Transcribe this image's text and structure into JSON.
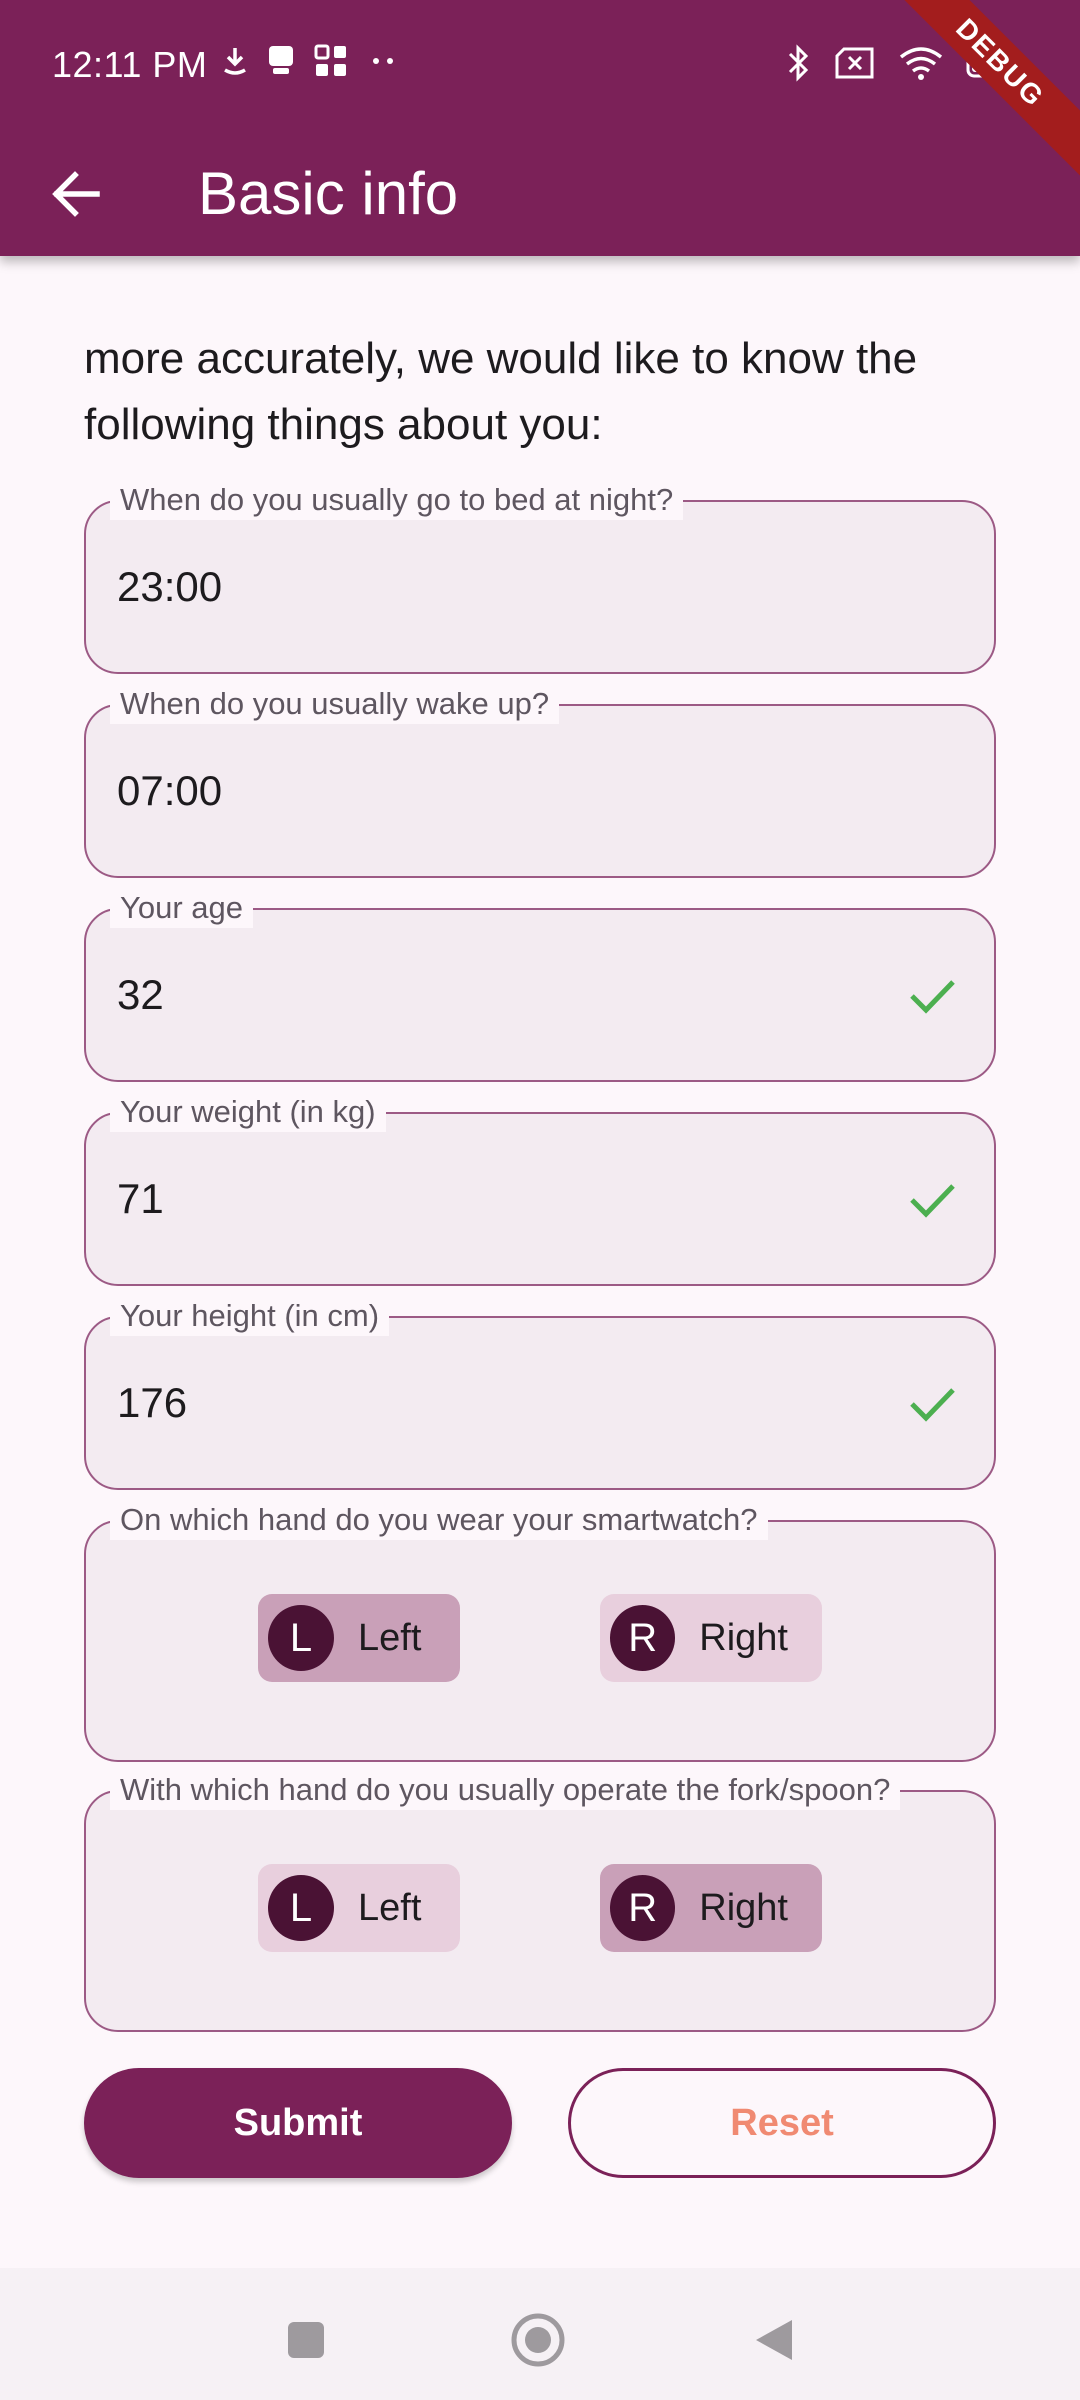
{
  "status_bar": {
    "time": "12:11 PM",
    "left_icons": [
      "download-icon",
      "notification-icon",
      "grid-icon",
      "more-dots-icon"
    ],
    "right_icons": [
      "bluetooth-icon",
      "sim-off-icon",
      "wifi-icon",
      "battery-icon"
    ]
  },
  "debug_banner": "DEBUG",
  "app_bar": {
    "title": "Basic info",
    "back_icon": "arrow-back-icon"
  },
  "intro_text": "more accurately, we would like to know the following things about you:",
  "fields": {
    "bedtime": {
      "label": "When do you usually go to bed at night?",
      "value": "23:00"
    },
    "wakeup": {
      "label": "When do you usually wake up?",
      "value": "07:00"
    },
    "age": {
      "label": "Your age",
      "value": "32",
      "valid": true
    },
    "weight": {
      "label": "Your weight (in kg)",
      "value": "71",
      "valid": true
    },
    "height": {
      "label": "Your height (in cm)",
      "value": "176",
      "valid": true
    }
  },
  "smartwatch_hand": {
    "label": "On which hand do you wear your smartwatch?",
    "options": [
      {
        "avatar": "L",
        "label": "Left",
        "selected": true
      },
      {
        "avatar": "R",
        "label": "Right",
        "selected": false
      }
    ]
  },
  "utensil_hand": {
    "label": "With which hand do you usually operate the fork/spoon?",
    "options": [
      {
        "avatar": "L",
        "label": "Left",
        "selected": false
      },
      {
        "avatar": "R",
        "label": "Right",
        "selected": true
      }
    ]
  },
  "buttons": {
    "submit": "Submit",
    "reset": "Reset"
  },
  "nav_bar": [
    "recents-square-icon",
    "home-circle-icon",
    "back-triangle-icon"
  ],
  "colors": {
    "primary": "#7b2158",
    "check_green": "#4caf50",
    "reset_text": "#f08a72",
    "field_bg": "#f3ebf1",
    "chip_selected": "#c9a0b8",
    "chip_unselected": "#e8cfdd"
  }
}
